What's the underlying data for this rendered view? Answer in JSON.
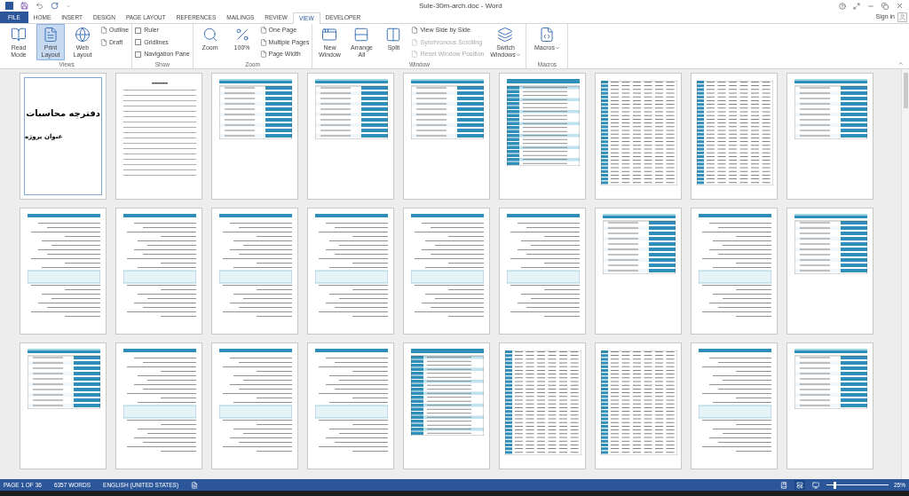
{
  "window": {
    "title": "Sule-30m-arch.doc - Word",
    "sign_in": "Sign in"
  },
  "tabs": [
    {
      "label": "FILE",
      "kind": "file",
      "selected": false
    },
    {
      "label": "HOME",
      "kind": "tab",
      "selected": false
    },
    {
      "label": "INSERT",
      "kind": "tab",
      "selected": false
    },
    {
      "label": "DESIGN",
      "kind": "tab",
      "selected": false
    },
    {
      "label": "PAGE LAYOUT",
      "kind": "tab",
      "selected": false
    },
    {
      "label": "REFERENCES",
      "kind": "tab",
      "selected": false
    },
    {
      "label": "MAILINGS",
      "kind": "tab",
      "selected": false
    },
    {
      "label": "REVIEW",
      "kind": "tab",
      "selected": false
    },
    {
      "label": "VIEW",
      "kind": "tab",
      "selected": true
    },
    {
      "label": "DEVELOPER",
      "kind": "tab",
      "selected": false
    }
  ],
  "ribbon": [
    {
      "label": "Views",
      "items": [
        {
          "kind": "large",
          "label": "Read Mode",
          "selected": false
        },
        {
          "kind": "large",
          "label": "Print Layout",
          "selected": true
        },
        {
          "kind": "large",
          "label": "Web Layout",
          "selected": false
        },
        {
          "kind": "stack",
          "entries": [
            {
              "kind": "small",
              "label": "Outline",
              "disabled": false
            },
            {
              "kind": "small",
              "label": "Draft",
              "disabled": false
            }
          ]
        }
      ]
    },
    {
      "label": "Show",
      "items": [
        {
          "kind": "stack",
          "entries": [
            {
              "kind": "check",
              "label": "Ruler",
              "checked": false
            },
            {
              "kind": "check",
              "label": "Gridlines",
              "checked": false
            },
            {
              "kind": "check",
              "label": "Navigation Pane",
              "checked": false
            }
          ]
        }
      ]
    },
    {
      "label": "Zoom",
      "items": [
        {
          "kind": "large",
          "label": "Zoom",
          "selected": false
        },
        {
          "kind": "large",
          "label": "100%",
          "selected": false
        },
        {
          "kind": "stack",
          "entries": [
            {
              "kind": "small",
              "label": "One Page",
              "disabled": false
            },
            {
              "kind": "small",
              "label": "Multiple Pages",
              "disabled": false
            },
            {
              "kind": "small",
              "label": "Page Width",
              "disabled": false
            }
          ]
        }
      ]
    },
    {
      "label": "Window",
      "items": [
        {
          "kind": "large",
          "label": "New Window",
          "selected": false
        },
        {
          "kind": "large",
          "label": "Arrange All",
          "selected": false
        },
        {
          "kind": "large",
          "label": "Split",
          "selected": false
        },
        {
          "kind": "stack",
          "entries": [
            {
              "kind": "small",
              "label": "View Side by Side",
              "disabled": false
            },
            {
              "kind": "small",
              "label": "Synchronous Scrolling",
              "disabled": true
            },
            {
              "kind": "small",
              "label": "Reset Window Position",
              "disabled": true
            }
          ]
        },
        {
          "kind": "dropdown",
          "label": "Switch Windows",
          "selected": false
        }
      ]
    },
    {
      "label": "Macros",
      "items": [
        {
          "kind": "dropdown",
          "label": "Macros",
          "selected": false
        }
      ]
    }
  ],
  "pages": [
    {
      "kind": "cover",
      "title": "دفترچه محاسبات",
      "subtitle": "عنوان پروژه"
    },
    {
      "kind": "toc"
    },
    {
      "kind": "form"
    },
    {
      "kind": "form"
    },
    {
      "kind": "form"
    },
    {
      "kind": "table"
    },
    {
      "kind": "grid"
    },
    {
      "kind": "grid"
    },
    {
      "kind": "form"
    },
    {
      "kind": "text"
    },
    {
      "kind": "text"
    },
    {
      "kind": "text"
    },
    {
      "kind": "text"
    },
    {
      "kind": "text"
    },
    {
      "kind": "text"
    },
    {
      "kind": "form"
    },
    {
      "kind": "text"
    },
    {
      "kind": "form"
    },
    {
      "kind": "form"
    },
    {
      "kind": "text"
    },
    {
      "kind": "text"
    },
    {
      "kind": "text"
    },
    {
      "kind": "table"
    },
    {
      "kind": "grid"
    },
    {
      "kind": "grid"
    },
    {
      "kind": "text"
    },
    {
      "kind": "form"
    }
  ],
  "status_bar": {
    "page": "PAGE 1 OF 36",
    "words": "6357 WORDS",
    "language": "ENGLISH (UNITED STATES)",
    "views": [
      {
        "selected": false
      },
      {
        "selected": true
      },
      {
        "selected": false
      }
    ],
    "zoom": {
      "level": 0.12,
      "reading": "25%"
    }
  }
}
